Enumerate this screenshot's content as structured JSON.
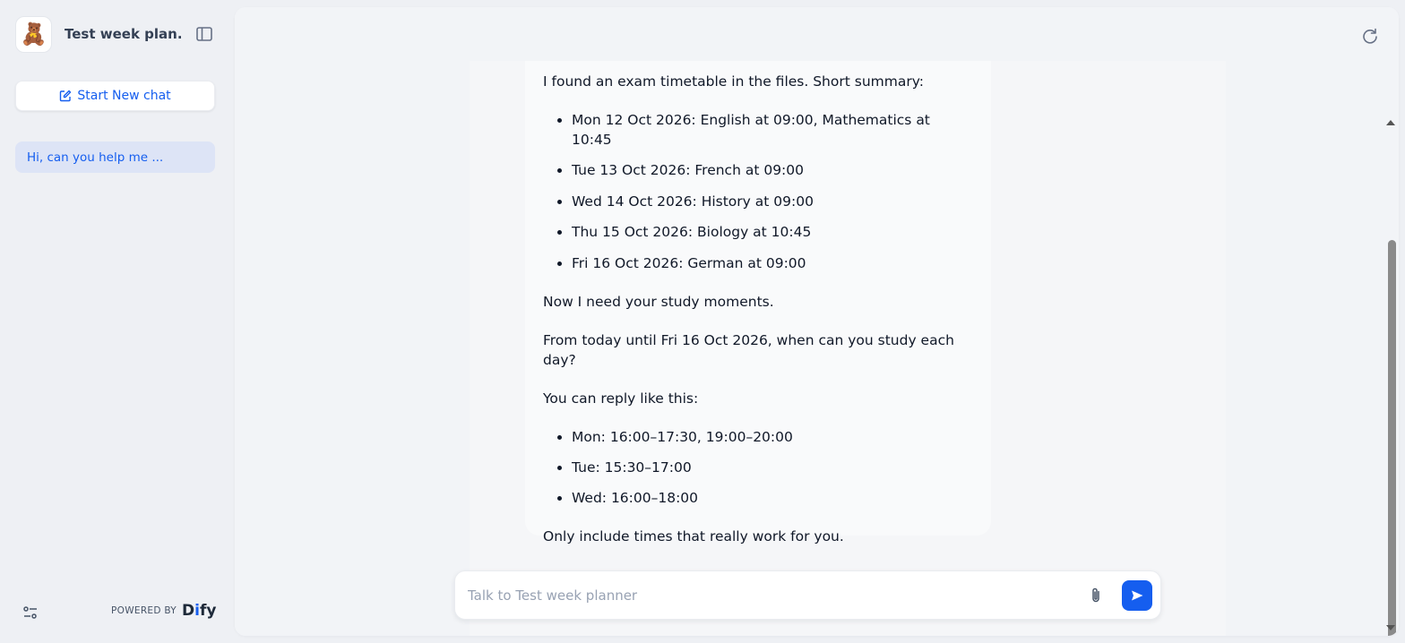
{
  "sidebar": {
    "app_icon": "teddy-bear-emoji",
    "app_emoji": "🧸",
    "app_title": "Test week plan...",
    "new_chat_label": "Start New chat",
    "conversations": [
      {
        "label": "Hi, can you help me ..."
      }
    ],
    "powered_by_label": "POWERED BY",
    "brand_name_prefix": "D",
    "brand_name_i": "i",
    "brand_name_suffix": "fy"
  },
  "message": {
    "intro": "I found an exam timetable in the files. Short summary:",
    "exams": [
      "Mon 12 Oct 2026: English at 09:00, Mathematics at 10:45",
      "Tue 13 Oct 2026: French at 09:00",
      "Wed 14 Oct 2026: History at 09:00",
      "Thu 15 Oct 2026: Biology at 10:45",
      "Fri 16 Oct 2026: German at 09:00"
    ],
    "need": "Now I need your study moments.",
    "question": "From today until Fri 16 Oct 2026, when can you study each day?",
    "reply_hint": "You can reply like this:",
    "examples": [
      "Mon: 16:00–17:30, 19:00–20:00",
      "Tue: 15:30–17:00",
      "Wed: 16:00–18:00"
    ],
    "closing": "Only include times that really work for you."
  },
  "composer": {
    "placeholder": "Talk to Test week planner",
    "value": ""
  },
  "colors": {
    "accent": "#155eef",
    "active_conversation_bg": "#dde4f6"
  }
}
